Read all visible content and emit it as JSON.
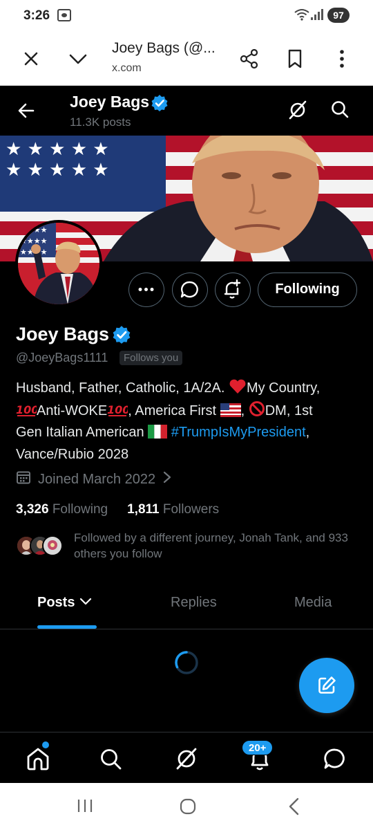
{
  "status_bar": {
    "time": "3:26",
    "battery": "97"
  },
  "browser": {
    "title": "Joey Bags (@...",
    "url": "x.com"
  },
  "header": {
    "name": "Joey Bags",
    "posts_count": "11.3K posts"
  },
  "profile": {
    "name": "Joey Bags",
    "handle": "@JoeyBags1111",
    "follows_you": "Follows you",
    "following_button": "Following",
    "bio": {
      "line1_a": "Husband, Father, Catholic, 1A/2A. ",
      "line1_b": "My Country,",
      "line2_a": "Anti-WOKE",
      "line2_b": ", America First ",
      "line2_c": ", ",
      "line2_d": "DM, 1st",
      "line3_a": "Gen Italian American ",
      "hashtag": "#TrumpIsMyPresident",
      "line3_b": ",",
      "line4": "Vance/Rubio 2028"
    },
    "joined": "Joined March 2022",
    "following_count": "3,326",
    "following_label": "Following",
    "followers_count": "1,811",
    "followers_label": "Followers",
    "followed_by": "Followed by a different journey, Jonah Tank, and 933 others you follow"
  },
  "tabs": {
    "posts": "Posts",
    "replies": "Replies",
    "media": "Media"
  },
  "bottom_nav": {
    "notifications_badge": "20+"
  },
  "colors": {
    "accent": "#1d9bf0",
    "background": "#000000",
    "secondary_text": "#71767b"
  },
  "icons": [
    "close-icon",
    "chevron-down-icon",
    "share-icon",
    "bookmark-icon",
    "more-vert-icon",
    "back-arrow-icon",
    "verified-icon",
    "grok-icon",
    "search-icon",
    "more-horiz-icon",
    "message-icon",
    "notification-add-icon",
    "calendar-icon",
    "chevron-right-icon",
    "compose-icon",
    "home-icon",
    "bell-icon",
    "mail-icon",
    "loading-spinner-icon"
  ]
}
